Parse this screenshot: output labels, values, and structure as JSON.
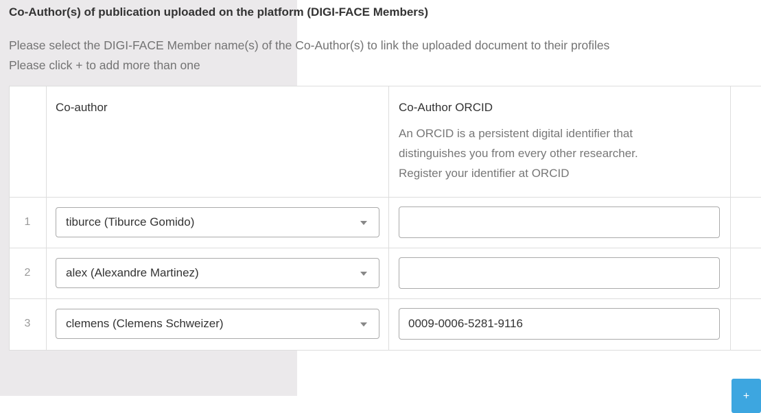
{
  "section": {
    "title": "Co-Author(s) of publication uploaded on the platform (DIGI-FACE Members)",
    "help_line1": "Please select the DIGI-FACE Member name(s) of the Co-Author(s) to link the uploaded document to their profiles",
    "help_line2": "Please click + to add more than one"
  },
  "table": {
    "col_coauthor": "Co-author",
    "col_orcid": "Co-Author ORCID",
    "orcid_desc_1": "An ORCID is a persistent digital identifier that",
    "orcid_desc_2": "distinguishes you from every other researcher.",
    "orcid_desc_3": "Register your identifier at ORCID",
    "rows": [
      {
        "num": "1",
        "coauthor": "tiburce (Tiburce Gomido)",
        "orcid": ""
      },
      {
        "num": "2",
        "coauthor": "alex (Alexandre Martinez)",
        "orcid": ""
      },
      {
        "num": "3",
        "coauthor": "clemens (Clemens Schweizer)",
        "orcid": "0009-0006-5281-9116"
      }
    ]
  },
  "actions": {
    "add_label": "+"
  },
  "colors": {
    "accent": "#3da6e0",
    "panel_bg": "#ebe9eb",
    "border": "#dddddd"
  },
  "icons": {
    "select_caret": "chevron-down-icon"
  }
}
